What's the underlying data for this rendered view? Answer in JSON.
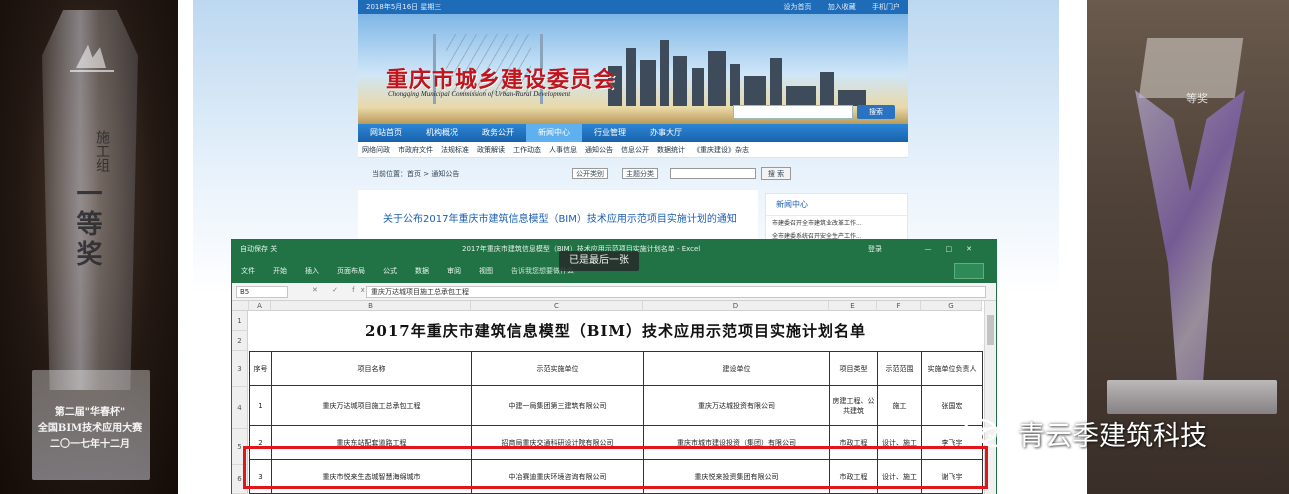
{
  "trophy_left": {
    "small_text": "施工组",
    "big_text": "一等奖",
    "plaque_lines": [
      "第二届\"华春杯\"",
      "全国BIM技术应用大赛",
      "二〇一七年十二月"
    ]
  },
  "trophy_right": {
    "crystal_text": "等奖"
  },
  "website": {
    "topbar_date": "2018年5月16日 星期三",
    "topbar_links": [
      "设为首页",
      "加入收藏",
      "手机门户"
    ],
    "banner_title": "重庆市城乡建设委员会",
    "banner_subtitle": "Chongqing Municipal Commission of Urban-Rural Development",
    "search_placeholder": "",
    "search_button": "搜索",
    "nav": [
      "网站首页",
      "机构概况",
      "政务公开",
      "新闻中心",
      "行业管理",
      "办事大厅"
    ],
    "nav_active": "新闻中心",
    "subnav": [
      "网络问政",
      "市政府文件",
      "法规标准",
      "政策解读",
      "工作动态",
      "人事信息",
      "通知公告",
      "信息公开",
      "数据统计",
      "《重庆建设》杂志"
    ],
    "filter": {
      "label": "当前位置：首页 > 通知公告",
      "sel1": "公开类别",
      "sel2": "主题分类",
      "go": "搜 索"
    },
    "article_title": "关于公布2017年重庆市建筑信息模型（BIM）技术应用示范项目实施计划的通知",
    "news": {
      "head": "新闻中心",
      "items": [
        "市建委召开全市建筑业改革工作...",
        "全市建委系统召开安全生产工作..."
      ]
    }
  },
  "excel": {
    "quick_access": "自动保存 关",
    "file_name": "2017年重庆市建筑信息模型（BIM）技术应用示范项目实施计划名单 - Excel",
    "user": "登录",
    "tabs": [
      "文件",
      "开始",
      "插入",
      "页面布局",
      "公式",
      "数据",
      "审阅",
      "视图",
      "告诉我您想要做什么"
    ],
    "name_box": "B5",
    "fx_symbols": "✕ ✓ fx",
    "formula_content": "重庆万达城项目施工总承包工程",
    "col_heads": [
      "A",
      "B",
      "C",
      "D",
      "E",
      "F",
      "G"
    ],
    "row_heads": [
      "1",
      "2",
      "3",
      "4",
      "5",
      "6"
    ],
    "sheet_title": "2017年重庆市建筑信息模型（BIM）技术应用示范项目实施计划名单",
    "table_headers": [
      "序号",
      "项目名称",
      "示范实施单位",
      "建设单位",
      "项目类型",
      "示范范围",
      "实施单位负责人"
    ],
    "rows": [
      [
        "1",
        "重庆万达城项目施工总承包工程",
        "中建一局集团第三建筑有限公司",
        "重庆万达城投资有限公司",
        "房建工程、公共建筑",
        "施工",
        "张国宏"
      ],
      [
        "2",
        "重庆东站配套道路工程",
        "招商局重庆交通科研设计院有限公司",
        "重庆市城市建设投资（集团）有限公司",
        "市政工程",
        "设计、施工",
        "李飞宇"
      ],
      [
        "3",
        "重庆市悦来生态城智慧海绵城市",
        "中冶赛迪重庆环境咨询有限公司",
        "重庆悦来投资集团有限公司",
        "市政工程",
        "设计、施工",
        "谢飞宇"
      ]
    ]
  },
  "toast": "已是最后一张",
  "watermark": {
    "text": "青云季建筑科技",
    "icon": "wechat-icon"
  }
}
